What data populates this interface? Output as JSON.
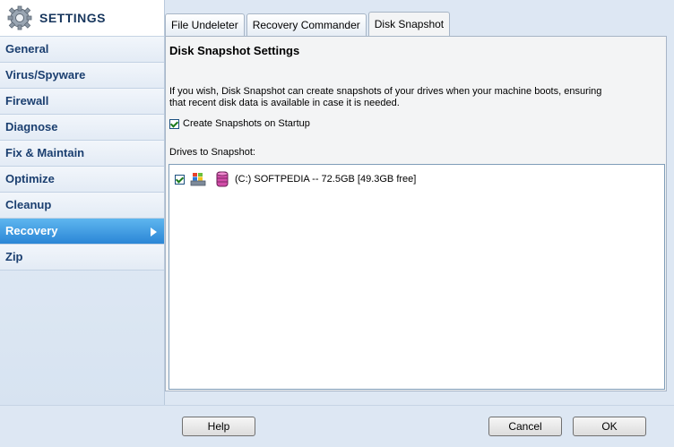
{
  "sidebar": {
    "title": "SETTINGS",
    "items": [
      {
        "label": "General"
      },
      {
        "label": "Virus/Spyware"
      },
      {
        "label": "Firewall"
      },
      {
        "label": "Diagnose"
      },
      {
        "label": "Fix & Maintain"
      },
      {
        "label": "Optimize"
      },
      {
        "label": "Cleanup"
      },
      {
        "label": "Recovery",
        "active": true
      },
      {
        "label": "Zip"
      }
    ]
  },
  "tabs": [
    {
      "label": "File Undeleter"
    },
    {
      "label": "Recovery Commander"
    },
    {
      "label": "Disk Snapshot",
      "active": true
    }
  ],
  "panel": {
    "title": "Disk Snapshot Settings",
    "description_line1": "If you wish, Disk Snapshot can create snapshots of your drives when your machine boots, ensuring",
    "description_line2": "that recent disk data is available in case it is needed.",
    "startup_checkbox_label": "Create Snapshots on Startup",
    "startup_checked": true,
    "drives_label": "Drives to Snapshot:",
    "drives": [
      {
        "label": "(C:) SOFTPEDIA --  72.5GB [49.3GB free]",
        "checked": true
      }
    ]
  },
  "buttons": {
    "help": "Help",
    "cancel": "Cancel",
    "ok": "OK"
  },
  "colors": {
    "active_item": "#2b86d6",
    "sidebar_text": "#1b3f70"
  }
}
